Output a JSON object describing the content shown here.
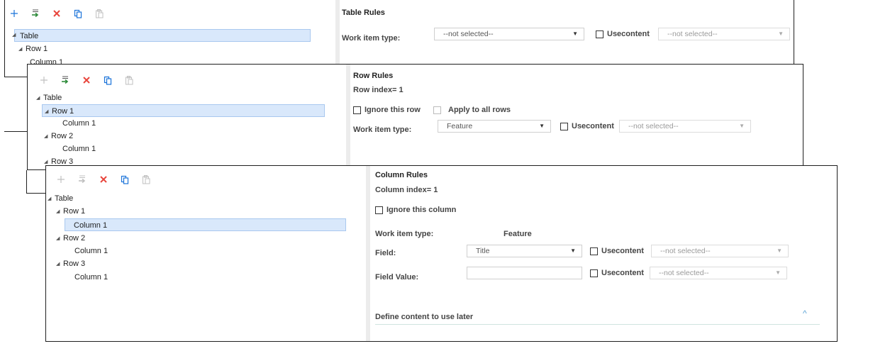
{
  "icons": {
    "add": "plus-icon",
    "add_child": "add-child-icon",
    "delete": "delete-icon",
    "copy": "copy-icon",
    "paste": "paste-icon"
  },
  "colors": {
    "add_icon": "#1a73d9",
    "add_child_icon": "#2e8b3a",
    "delete_icon": "#e8453c",
    "copy_icon": "#1a73d9",
    "disabled_icon": "#c0c0c0",
    "selection": "#d9e8fb"
  },
  "panel1": {
    "tree": {
      "table": "Table",
      "row1": "Row 1",
      "row1_col": "Column 1"
    },
    "title": "Table Rules",
    "work_item_label": "Work item type:",
    "work_item_value": "--not selected--",
    "usecontent_label": "Usecontent",
    "usecontent_value": "--not selected--"
  },
  "panel2": {
    "tree": {
      "table": "Table",
      "row1": "Row 1",
      "row1_col": "Column 1",
      "row2": "Row 2",
      "row2_col": "Column 1",
      "row3": "Row 3"
    },
    "title": "Row Rules",
    "row_index": "Row index= 1",
    "ignore_label": "Ignore this row",
    "apply_label": "Apply to all rows",
    "work_item_label": "Work item type:",
    "work_item_value": "Feature",
    "usecontent_label": "Usecontent",
    "usecontent_value": "--not selected--"
  },
  "panel3": {
    "tree": {
      "table": "Table",
      "row1": "Row 1",
      "row1_col": "Column 1",
      "row2": "Row 2",
      "row2_col": "Column 1",
      "row3": "Row 3",
      "row3_col": "Column 1"
    },
    "title": "Column Rules",
    "column_index": "Column index= 1",
    "ignore_label": "Ignore this column",
    "work_item_label": "Work item type:",
    "work_item_value": "Feature",
    "field_label": "Field:",
    "field_value": "Title",
    "field_usecontent_label": "Usecontent",
    "field_usecontent_value": "--not selected--",
    "field_value_label": "Field Value:",
    "field_value_input": "",
    "fv_usecontent_label": "Usecontent",
    "fv_usecontent_value": "--not selected--",
    "section_title": "Define content to use later"
  }
}
